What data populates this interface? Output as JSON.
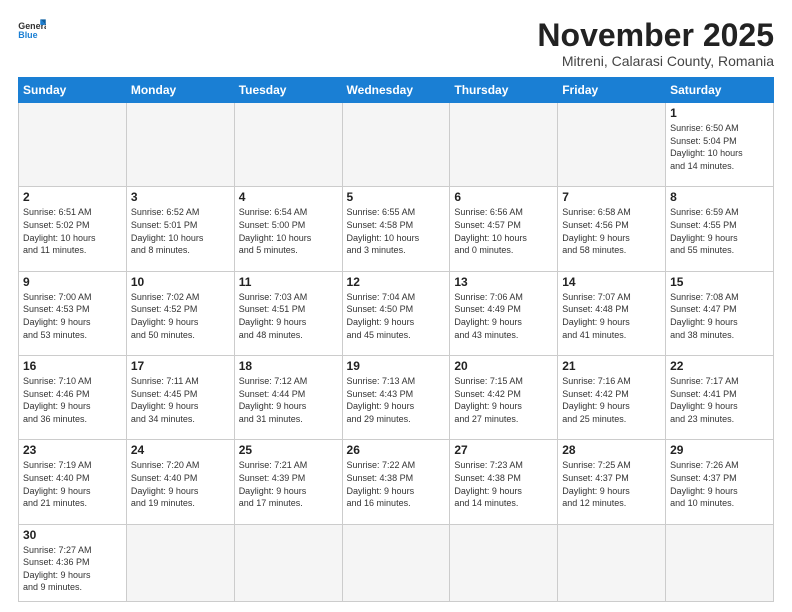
{
  "header": {
    "logo_general": "General",
    "logo_blue": "Blue",
    "month_title": "November 2025",
    "location": "Mitreni, Calarasi County, Romania"
  },
  "days_of_week": [
    "Sunday",
    "Monday",
    "Tuesday",
    "Wednesday",
    "Thursday",
    "Friday",
    "Saturday"
  ],
  "weeks": [
    [
      {
        "day": "",
        "info": ""
      },
      {
        "day": "",
        "info": ""
      },
      {
        "day": "",
        "info": ""
      },
      {
        "day": "",
        "info": ""
      },
      {
        "day": "",
        "info": ""
      },
      {
        "day": "",
        "info": ""
      },
      {
        "day": "1",
        "info": "Sunrise: 6:50 AM\nSunset: 5:04 PM\nDaylight: 10 hours\nand 14 minutes."
      }
    ],
    [
      {
        "day": "2",
        "info": "Sunrise: 6:51 AM\nSunset: 5:02 PM\nDaylight: 10 hours\nand 11 minutes."
      },
      {
        "day": "3",
        "info": "Sunrise: 6:52 AM\nSunset: 5:01 PM\nDaylight: 10 hours\nand 8 minutes."
      },
      {
        "day": "4",
        "info": "Sunrise: 6:54 AM\nSunset: 5:00 PM\nDaylight: 10 hours\nand 5 minutes."
      },
      {
        "day": "5",
        "info": "Sunrise: 6:55 AM\nSunset: 4:58 PM\nDaylight: 10 hours\nand 3 minutes."
      },
      {
        "day": "6",
        "info": "Sunrise: 6:56 AM\nSunset: 4:57 PM\nDaylight: 10 hours\nand 0 minutes."
      },
      {
        "day": "7",
        "info": "Sunrise: 6:58 AM\nSunset: 4:56 PM\nDaylight: 9 hours\nand 58 minutes."
      },
      {
        "day": "8",
        "info": "Sunrise: 6:59 AM\nSunset: 4:55 PM\nDaylight: 9 hours\nand 55 minutes."
      }
    ],
    [
      {
        "day": "9",
        "info": "Sunrise: 7:00 AM\nSunset: 4:53 PM\nDaylight: 9 hours\nand 53 minutes."
      },
      {
        "day": "10",
        "info": "Sunrise: 7:02 AM\nSunset: 4:52 PM\nDaylight: 9 hours\nand 50 minutes."
      },
      {
        "day": "11",
        "info": "Sunrise: 7:03 AM\nSunset: 4:51 PM\nDaylight: 9 hours\nand 48 minutes."
      },
      {
        "day": "12",
        "info": "Sunrise: 7:04 AM\nSunset: 4:50 PM\nDaylight: 9 hours\nand 45 minutes."
      },
      {
        "day": "13",
        "info": "Sunrise: 7:06 AM\nSunset: 4:49 PM\nDaylight: 9 hours\nand 43 minutes."
      },
      {
        "day": "14",
        "info": "Sunrise: 7:07 AM\nSunset: 4:48 PM\nDaylight: 9 hours\nand 41 minutes."
      },
      {
        "day": "15",
        "info": "Sunrise: 7:08 AM\nSunset: 4:47 PM\nDaylight: 9 hours\nand 38 minutes."
      }
    ],
    [
      {
        "day": "16",
        "info": "Sunrise: 7:10 AM\nSunset: 4:46 PM\nDaylight: 9 hours\nand 36 minutes."
      },
      {
        "day": "17",
        "info": "Sunrise: 7:11 AM\nSunset: 4:45 PM\nDaylight: 9 hours\nand 34 minutes."
      },
      {
        "day": "18",
        "info": "Sunrise: 7:12 AM\nSunset: 4:44 PM\nDaylight: 9 hours\nand 31 minutes."
      },
      {
        "day": "19",
        "info": "Sunrise: 7:13 AM\nSunset: 4:43 PM\nDaylight: 9 hours\nand 29 minutes."
      },
      {
        "day": "20",
        "info": "Sunrise: 7:15 AM\nSunset: 4:42 PM\nDaylight: 9 hours\nand 27 minutes."
      },
      {
        "day": "21",
        "info": "Sunrise: 7:16 AM\nSunset: 4:42 PM\nDaylight: 9 hours\nand 25 minutes."
      },
      {
        "day": "22",
        "info": "Sunrise: 7:17 AM\nSunset: 4:41 PM\nDaylight: 9 hours\nand 23 minutes."
      }
    ],
    [
      {
        "day": "23",
        "info": "Sunrise: 7:19 AM\nSunset: 4:40 PM\nDaylight: 9 hours\nand 21 minutes."
      },
      {
        "day": "24",
        "info": "Sunrise: 7:20 AM\nSunset: 4:40 PM\nDaylight: 9 hours\nand 19 minutes."
      },
      {
        "day": "25",
        "info": "Sunrise: 7:21 AM\nSunset: 4:39 PM\nDaylight: 9 hours\nand 17 minutes."
      },
      {
        "day": "26",
        "info": "Sunrise: 7:22 AM\nSunset: 4:38 PM\nDaylight: 9 hours\nand 16 minutes."
      },
      {
        "day": "27",
        "info": "Sunrise: 7:23 AM\nSunset: 4:38 PM\nDaylight: 9 hours\nand 14 minutes."
      },
      {
        "day": "28",
        "info": "Sunrise: 7:25 AM\nSunset: 4:37 PM\nDaylight: 9 hours\nand 12 minutes."
      },
      {
        "day": "29",
        "info": "Sunrise: 7:26 AM\nSunset: 4:37 PM\nDaylight: 9 hours\nand 10 minutes."
      }
    ],
    [
      {
        "day": "30",
        "info": "Sunrise: 7:27 AM\nSunset: 4:36 PM\nDaylight: 9 hours\nand 9 minutes."
      },
      {
        "day": "",
        "info": ""
      },
      {
        "day": "",
        "info": ""
      },
      {
        "day": "",
        "info": ""
      },
      {
        "day": "",
        "info": ""
      },
      {
        "day": "",
        "info": ""
      },
      {
        "day": "",
        "info": ""
      }
    ]
  ]
}
